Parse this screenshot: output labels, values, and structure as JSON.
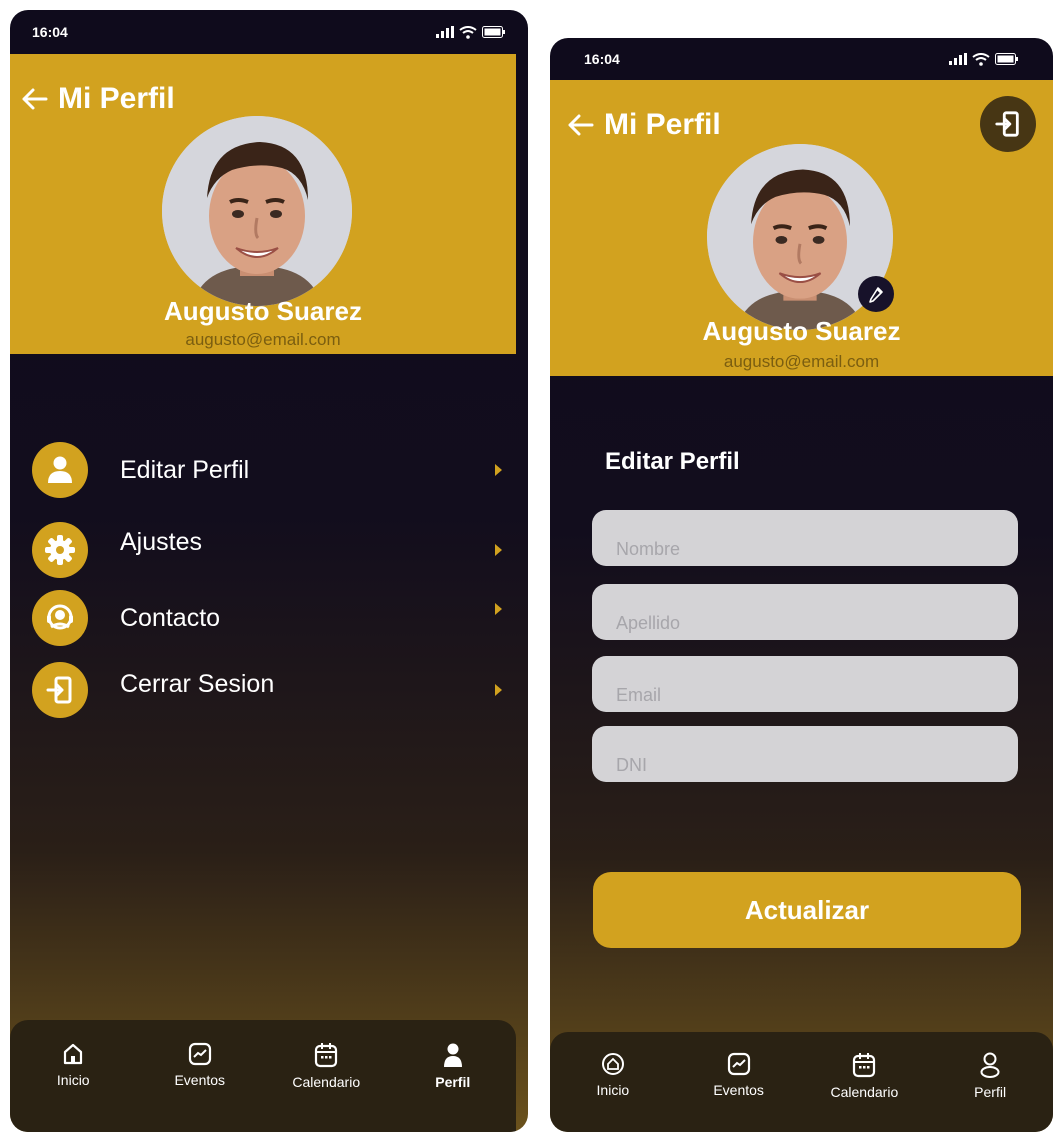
{
  "colors": {
    "accent": "#d2a21f",
    "background_dark": "#0f0b1c",
    "field_bg": "#d4d3d6",
    "nav_bg": "#2a2213"
  },
  "screen_menu": {
    "status": {
      "time": "16:04"
    },
    "header": {
      "title": "Mi Perfil",
      "back_icon": "arrow-left-icon"
    },
    "user": {
      "name": "Augusto Suarez",
      "email": "augusto@email.com"
    },
    "menu": [
      {
        "label": "Editar Perfil",
        "icon": "person-icon"
      },
      {
        "label": "Ajustes",
        "icon": "gear-icon"
      },
      {
        "label": "Contacto",
        "icon": "headset-icon"
      },
      {
        "label": "Cerrar Sesion",
        "icon": "logout-icon"
      }
    ],
    "nav": [
      {
        "label": "Inicio",
        "icon": "home-icon"
      },
      {
        "label": "Eventos",
        "icon": "trend-chart-icon"
      },
      {
        "label": "Calendario",
        "icon": "calendar-icon"
      },
      {
        "label": "Perfil",
        "icon": "person-icon",
        "active": true
      }
    ]
  },
  "screen_edit": {
    "status": {
      "time": "16:04"
    },
    "header": {
      "title": "Mi Perfil",
      "back_icon": "arrow-left-icon",
      "logout_icon": "logout-icon"
    },
    "user": {
      "name": "Augusto Suarez",
      "email": "augusto@email.com"
    },
    "form": {
      "title": "Editar Perfil",
      "fields": [
        {
          "placeholder": "Nombre",
          "value": ""
        },
        {
          "placeholder": "Apellido",
          "value": ""
        },
        {
          "placeholder": "Email",
          "value": ""
        },
        {
          "placeholder": "DNI",
          "value": ""
        }
      ],
      "submit_label": "Actualizar"
    },
    "nav": [
      {
        "label": "Inicio",
        "icon": "home-icon"
      },
      {
        "label": "Eventos",
        "icon": "trend-chart-icon"
      },
      {
        "label": "Calendario",
        "icon": "calendar-icon"
      },
      {
        "label": "Perfil",
        "icon": "person-outline-icon",
        "active": true
      }
    ]
  }
}
